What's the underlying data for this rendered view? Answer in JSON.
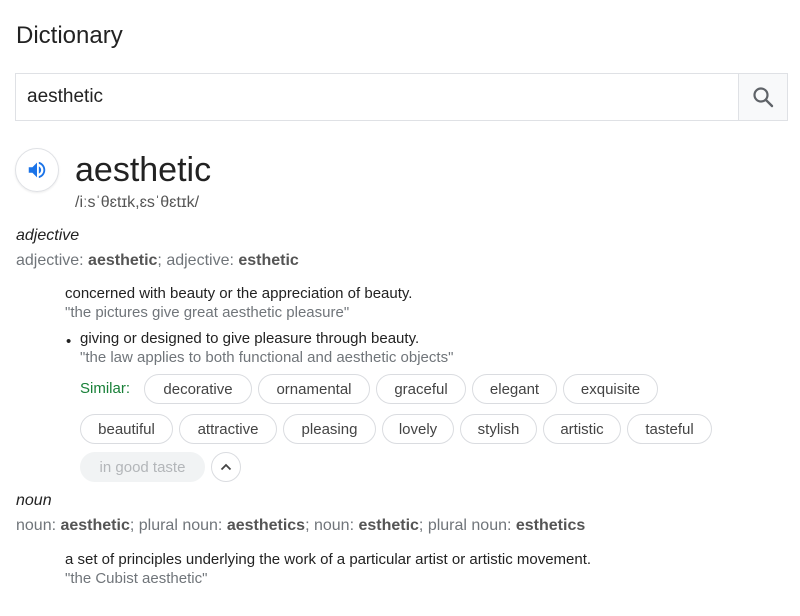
{
  "header": {
    "title": "Dictionary"
  },
  "search": {
    "value": "aesthetic",
    "icon": "search-icon"
  },
  "entry": {
    "word": "aesthetic",
    "phonetic": "/iːsˈθɛtɪk,ɛsˈθɛtɪk/",
    "speaker_icon": "speaker-icon",
    "accent_color": "#1a73e8"
  },
  "adjective": {
    "pos": "adjective",
    "forms": [
      {
        "label": "adjective: ",
        "word": "aesthetic",
        "sep": "; "
      },
      {
        "label": "adjective: ",
        "word": "esthetic",
        "sep": ""
      }
    ],
    "definition_1": "concerned with beauty or the appreciation of beauty.",
    "example_1": "\"the pictures give great aesthetic pleasure\"",
    "bullet": "•",
    "definition_2": "giving or designed to give pleasure through beauty.",
    "example_2": "\"the law applies to both functional and aesthetic objects\"",
    "similar_label": "Similar:",
    "similar": [
      "decorative",
      "ornamental",
      "graceful",
      "elegant",
      "exquisite",
      "beautiful",
      "attractive",
      "pleasing",
      "lovely",
      "stylish",
      "artistic",
      "tasteful",
      "in good taste"
    ],
    "similar_color": "#188038"
  },
  "noun": {
    "pos": "noun",
    "forms": [
      {
        "label": "noun: ",
        "word": "aesthetic",
        "sep": "; "
      },
      {
        "label": "plural noun: ",
        "word": "aesthetics",
        "sep": "; "
      },
      {
        "label": "noun: ",
        "word": "esthetic",
        "sep": "; "
      },
      {
        "label": "plural noun: ",
        "word": "esthetics",
        "sep": ""
      }
    ],
    "definition_1": "a set of principles underlying the work of a particular artist or artistic movement.",
    "example_1": "\"the Cubist aesthetic\""
  }
}
